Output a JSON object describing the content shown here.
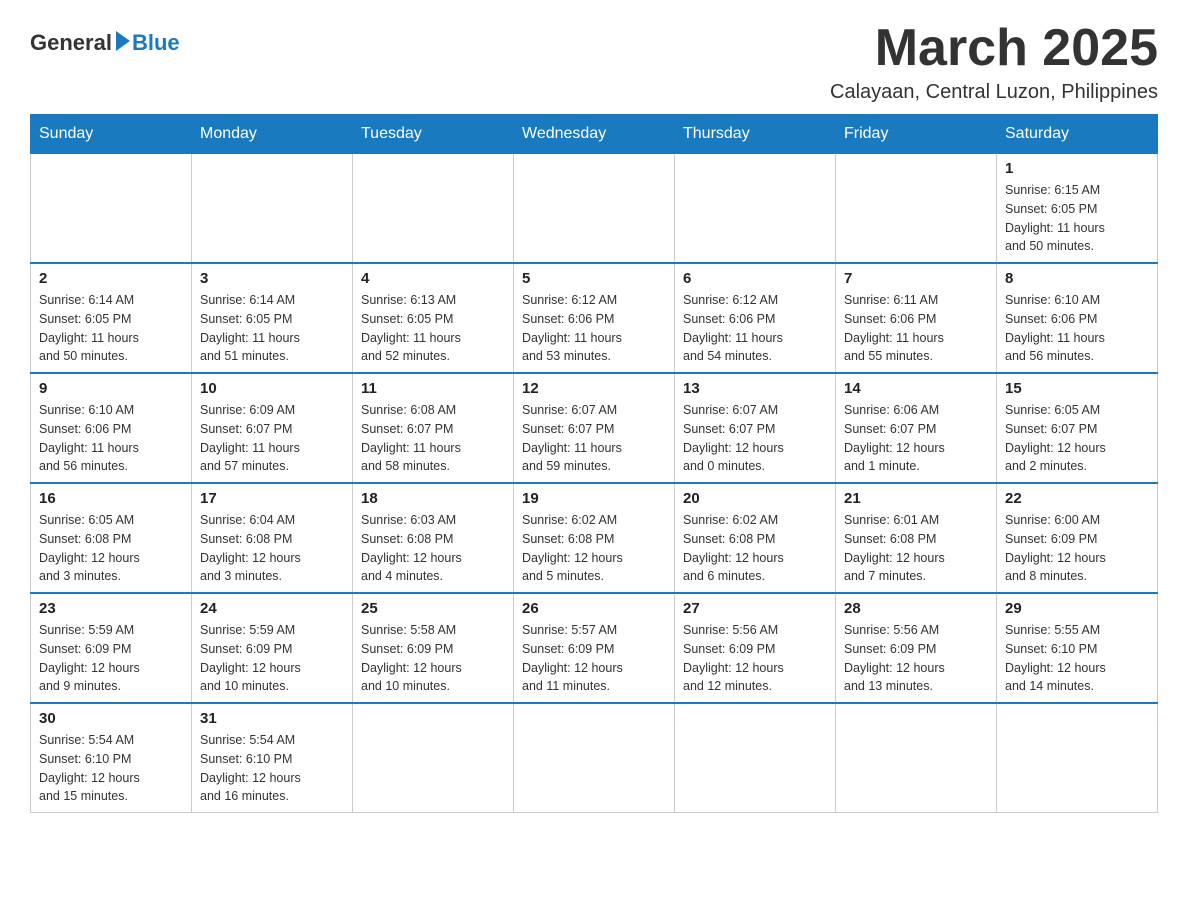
{
  "header": {
    "logo_general": "General",
    "logo_blue": "Blue",
    "month": "March 2025",
    "location": "Calayaan, Central Luzon, Philippines"
  },
  "days_of_week": [
    "Sunday",
    "Monday",
    "Tuesday",
    "Wednesday",
    "Thursday",
    "Friday",
    "Saturday"
  ],
  "weeks": [
    [
      {
        "day": "",
        "info": ""
      },
      {
        "day": "",
        "info": ""
      },
      {
        "day": "",
        "info": ""
      },
      {
        "day": "",
        "info": ""
      },
      {
        "day": "",
        "info": ""
      },
      {
        "day": "",
        "info": ""
      },
      {
        "day": "1",
        "info": "Sunrise: 6:15 AM\nSunset: 6:05 PM\nDaylight: 11 hours\nand 50 minutes."
      }
    ],
    [
      {
        "day": "2",
        "info": "Sunrise: 6:14 AM\nSunset: 6:05 PM\nDaylight: 11 hours\nand 50 minutes."
      },
      {
        "day": "3",
        "info": "Sunrise: 6:14 AM\nSunset: 6:05 PM\nDaylight: 11 hours\nand 51 minutes."
      },
      {
        "day": "4",
        "info": "Sunrise: 6:13 AM\nSunset: 6:05 PM\nDaylight: 11 hours\nand 52 minutes."
      },
      {
        "day": "5",
        "info": "Sunrise: 6:12 AM\nSunset: 6:06 PM\nDaylight: 11 hours\nand 53 minutes."
      },
      {
        "day": "6",
        "info": "Sunrise: 6:12 AM\nSunset: 6:06 PM\nDaylight: 11 hours\nand 54 minutes."
      },
      {
        "day": "7",
        "info": "Sunrise: 6:11 AM\nSunset: 6:06 PM\nDaylight: 11 hours\nand 55 minutes."
      },
      {
        "day": "8",
        "info": "Sunrise: 6:10 AM\nSunset: 6:06 PM\nDaylight: 11 hours\nand 56 minutes."
      }
    ],
    [
      {
        "day": "9",
        "info": "Sunrise: 6:10 AM\nSunset: 6:06 PM\nDaylight: 11 hours\nand 56 minutes."
      },
      {
        "day": "10",
        "info": "Sunrise: 6:09 AM\nSunset: 6:07 PM\nDaylight: 11 hours\nand 57 minutes."
      },
      {
        "day": "11",
        "info": "Sunrise: 6:08 AM\nSunset: 6:07 PM\nDaylight: 11 hours\nand 58 minutes."
      },
      {
        "day": "12",
        "info": "Sunrise: 6:07 AM\nSunset: 6:07 PM\nDaylight: 11 hours\nand 59 minutes."
      },
      {
        "day": "13",
        "info": "Sunrise: 6:07 AM\nSunset: 6:07 PM\nDaylight: 12 hours\nand 0 minutes."
      },
      {
        "day": "14",
        "info": "Sunrise: 6:06 AM\nSunset: 6:07 PM\nDaylight: 12 hours\nand 1 minute."
      },
      {
        "day": "15",
        "info": "Sunrise: 6:05 AM\nSunset: 6:07 PM\nDaylight: 12 hours\nand 2 minutes."
      }
    ],
    [
      {
        "day": "16",
        "info": "Sunrise: 6:05 AM\nSunset: 6:08 PM\nDaylight: 12 hours\nand 3 minutes."
      },
      {
        "day": "17",
        "info": "Sunrise: 6:04 AM\nSunset: 6:08 PM\nDaylight: 12 hours\nand 3 minutes."
      },
      {
        "day": "18",
        "info": "Sunrise: 6:03 AM\nSunset: 6:08 PM\nDaylight: 12 hours\nand 4 minutes."
      },
      {
        "day": "19",
        "info": "Sunrise: 6:02 AM\nSunset: 6:08 PM\nDaylight: 12 hours\nand 5 minutes."
      },
      {
        "day": "20",
        "info": "Sunrise: 6:02 AM\nSunset: 6:08 PM\nDaylight: 12 hours\nand 6 minutes."
      },
      {
        "day": "21",
        "info": "Sunrise: 6:01 AM\nSunset: 6:08 PM\nDaylight: 12 hours\nand 7 minutes."
      },
      {
        "day": "22",
        "info": "Sunrise: 6:00 AM\nSunset: 6:09 PM\nDaylight: 12 hours\nand 8 minutes."
      }
    ],
    [
      {
        "day": "23",
        "info": "Sunrise: 5:59 AM\nSunset: 6:09 PM\nDaylight: 12 hours\nand 9 minutes."
      },
      {
        "day": "24",
        "info": "Sunrise: 5:59 AM\nSunset: 6:09 PM\nDaylight: 12 hours\nand 10 minutes."
      },
      {
        "day": "25",
        "info": "Sunrise: 5:58 AM\nSunset: 6:09 PM\nDaylight: 12 hours\nand 10 minutes."
      },
      {
        "day": "26",
        "info": "Sunrise: 5:57 AM\nSunset: 6:09 PM\nDaylight: 12 hours\nand 11 minutes."
      },
      {
        "day": "27",
        "info": "Sunrise: 5:56 AM\nSunset: 6:09 PM\nDaylight: 12 hours\nand 12 minutes."
      },
      {
        "day": "28",
        "info": "Sunrise: 5:56 AM\nSunset: 6:09 PM\nDaylight: 12 hours\nand 13 minutes."
      },
      {
        "day": "29",
        "info": "Sunrise: 5:55 AM\nSunset: 6:10 PM\nDaylight: 12 hours\nand 14 minutes."
      }
    ],
    [
      {
        "day": "30",
        "info": "Sunrise: 5:54 AM\nSunset: 6:10 PM\nDaylight: 12 hours\nand 15 minutes."
      },
      {
        "day": "31",
        "info": "Sunrise: 5:54 AM\nSunset: 6:10 PM\nDaylight: 12 hours\nand 16 minutes."
      },
      {
        "day": "",
        "info": ""
      },
      {
        "day": "",
        "info": ""
      },
      {
        "day": "",
        "info": ""
      },
      {
        "day": "",
        "info": ""
      },
      {
        "day": "",
        "info": ""
      }
    ]
  ]
}
